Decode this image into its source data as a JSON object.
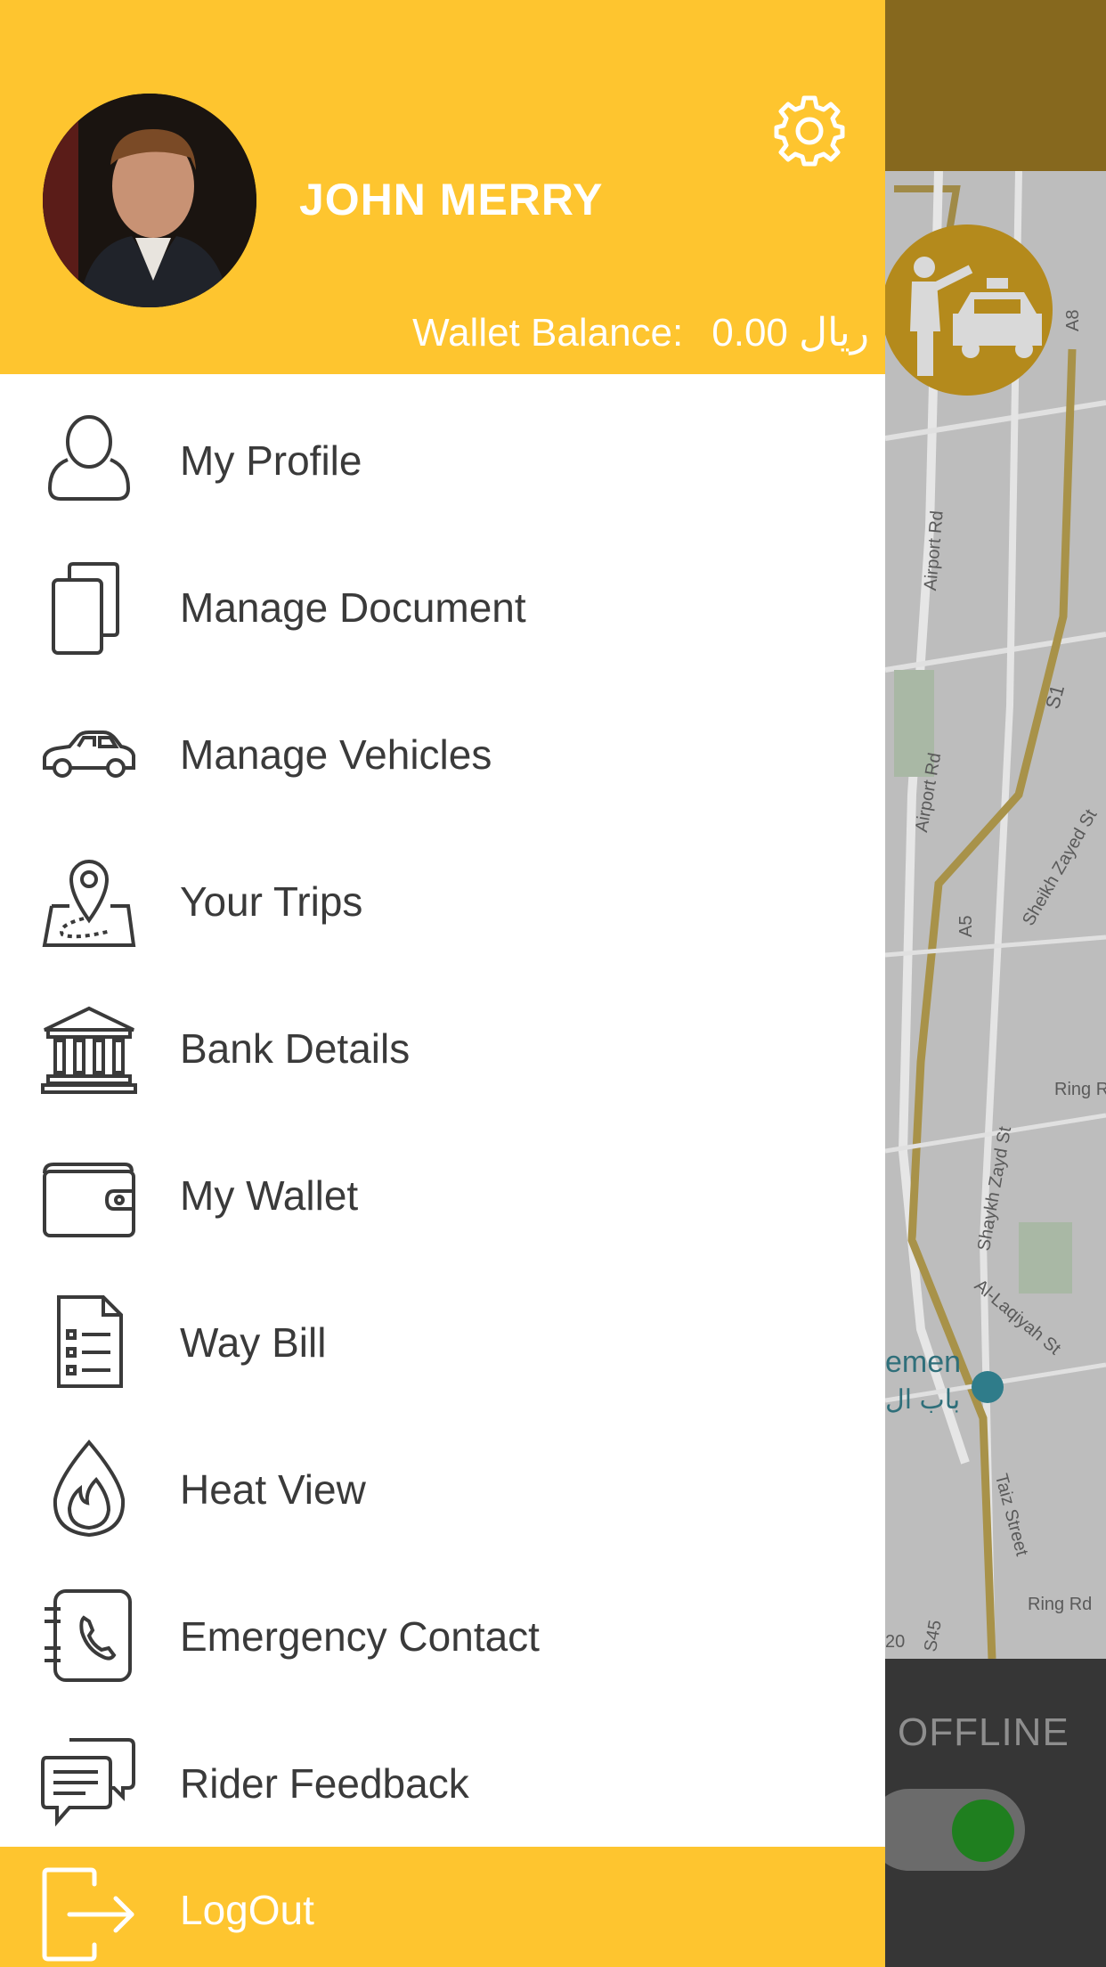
{
  "header": {
    "user_name": "JOHN MERRY",
    "wallet_label": "Wallet Balance:",
    "wallet_amount": "0.00",
    "wallet_currency": "ريال"
  },
  "menu": {
    "items": [
      {
        "label": "My Profile",
        "icon": "user-icon"
      },
      {
        "label": "Manage Document",
        "icon": "documents-icon"
      },
      {
        "label": "Manage Vehicles",
        "icon": "car-icon"
      },
      {
        "label": "Your Trips",
        "icon": "map-pin-icon"
      },
      {
        "label": "Bank Details",
        "icon": "bank-icon"
      },
      {
        "label": "My Wallet",
        "icon": "wallet-icon"
      },
      {
        "label": "Way Bill",
        "icon": "checklist-icon"
      },
      {
        "label": "Heat View",
        "icon": "flame-icon"
      },
      {
        "label": "Emergency Contact",
        "icon": "phone-book-icon"
      },
      {
        "label": "Rider Feedback",
        "icon": "chat-icon"
      }
    ],
    "logout_label": "LogOut"
  },
  "map": {
    "labels": [
      "Airport Rd",
      "Airport Rd",
      "S1",
      "Sheikh Zayed St",
      "A5",
      "A8",
      "Ring R",
      "Shaykh Zayd St",
      "Al-Laqiyah St",
      "Taiz Street",
      "emen",
      "باب ال",
      "S45",
      "20",
      "Ring Rd"
    ]
  },
  "status": {
    "text": "OFFLINE"
  },
  "colors": {
    "accent": "#fec52f",
    "text": "#3a3a3a",
    "toggle_on": "#1f7f1f"
  }
}
